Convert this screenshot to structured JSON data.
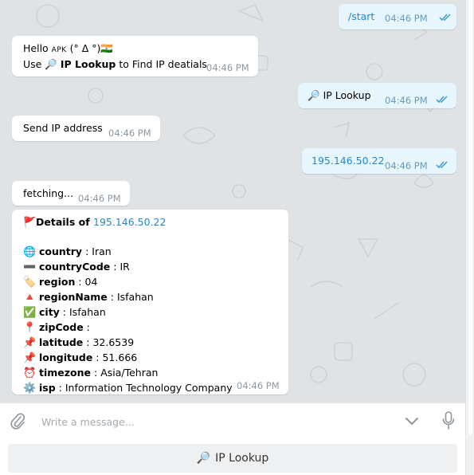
{
  "messages": {
    "start": {
      "text": "/start",
      "time": "04:46 PM"
    },
    "hello": {
      "line1_prefix": "Hello ",
      "name": "APK",
      "line1_suffix": " (° Δ °)",
      "flag": "🇮🇳",
      "line2_prefix": "Use ",
      "icon": "🔎",
      "link_label": "IP Lookup",
      "line2_suffix": " to Find IP deatials",
      "time": "04:46 PM"
    },
    "ip_lookup": {
      "icon": "🔎",
      "text": "IP Lookup",
      "time": "04:46 PM"
    },
    "send_ip": {
      "text": "Send IP address",
      "time": "04:46 PM"
    },
    "ip_sent": {
      "text": "195.146.50.22",
      "time": "04:46 PM"
    },
    "fetching": {
      "text": "fetching...",
      "time": "04:46 PM"
    },
    "details": {
      "flag_icon": "🚩",
      "title_prefix": "Details of ",
      "ip": "195.146.50.22",
      "rows": [
        {
          "icon": "🌐",
          "label": "country",
          "value": "Iran"
        },
        {
          "icon": "➖",
          "label": "countryCode",
          "value": "IR"
        },
        {
          "icon": "🏷️",
          "label": "region",
          "value": "04"
        },
        {
          "icon": "🔺",
          "label": "regionName",
          "value": "Isfahan"
        },
        {
          "icon": "✅",
          "label": "city",
          "value": "Isfahan"
        },
        {
          "icon": "📍",
          "label": "zipCode",
          "value": ""
        },
        {
          "icon": "📌",
          "label": "latitude",
          "value": "32.6539"
        },
        {
          "icon": "📌",
          "label": "longitude",
          "value": "51.666"
        },
        {
          "icon": "⏰",
          "label": "timezone",
          "value": "Asia/Tehran"
        },
        {
          "icon": "⚙️",
          "label": "isp",
          "value": "Information Technology Company"
        }
      ],
      "separator": " : ",
      "time": "04:46 PM"
    }
  },
  "composer": {
    "placeholder": "Write a message..."
  },
  "keyboard": {
    "button_icon": "🔎",
    "button_label": "IP Lookup"
  },
  "colors": {
    "chat_background": "#dfe3e6",
    "outgoing_bubble": "#e6f6fc",
    "incoming_bubble": "#ffffff",
    "link": "#2a86c5",
    "read_ticks": "#3d9ad6"
  },
  "icons": {
    "attach": "paperclip-icon",
    "scroll_down": "chevron-down-icon",
    "voice": "microphone-icon",
    "read_status": "double-check-icon"
  }
}
